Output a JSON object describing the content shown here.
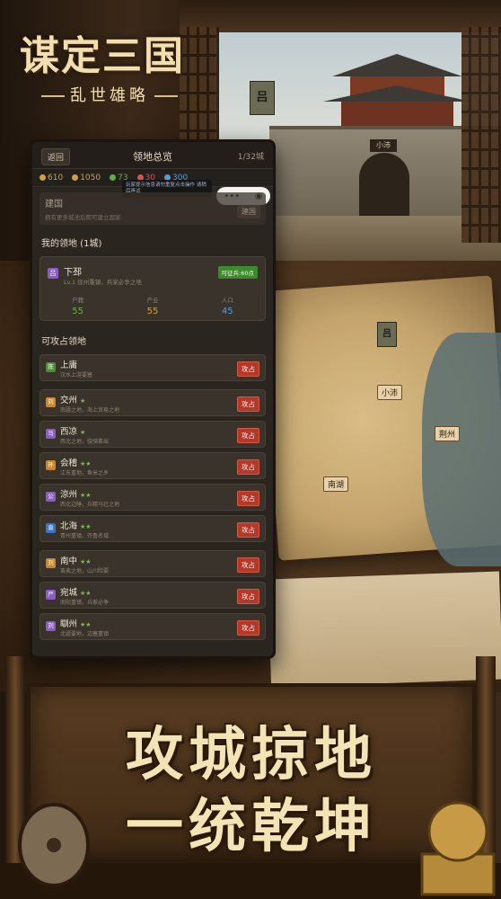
{
  "logo": {
    "title": "谋定三国",
    "subtitle": "乱世雄略"
  },
  "slogan": {
    "line1": "攻城掠地",
    "line2": "一统乾坤"
  },
  "scene": {
    "flag_char": "吕",
    "gate_plaque": "小沛",
    "map_labels": [
      "小沛",
      "荆州",
      "南湖"
    ]
  },
  "panel": {
    "back_label": "返回",
    "title": "领地总览",
    "count": "1/32城",
    "resources": [
      {
        "icon": "coin-icon",
        "value": "610",
        "color": "#c9a24a"
      },
      {
        "icon": "food-icon",
        "value": "1050",
        "color": "#c9a24a"
      },
      {
        "icon": "soldier-icon",
        "value": "73",
        "color": "#6aa84f"
      },
      {
        "icon": "power-icon",
        "value": "30",
        "color": "#d9534f"
      },
      {
        "icon": "gem-icon",
        "value": "300",
        "color": "#5b9bd5"
      }
    ],
    "toast": "玩家提示信息请勿重复点击操作 请稍后再试",
    "build": {
      "title": "建国",
      "desc": "拥有更多城池后即可建立国家",
      "button": "建国"
    },
    "own_section": "我的领地 (1城)",
    "own_city": {
      "badge": "吕",
      "name": "下邳",
      "sub": "Lv.1 徐州重镇，兵家必争之地",
      "tag": "可征兵:60点",
      "stats": [
        {
          "label": "户籍",
          "value": "55",
          "color": "#6aa84f"
        },
        {
          "label": "产业",
          "value": "55",
          "color": "#d4a03a"
        },
        {
          "label": "人口",
          "value": "45",
          "color": "#5b9bd5"
        }
      ]
    },
    "attack_section": "可攻占领地",
    "attack_label": "攻占",
    "targets": [
      {
        "badge": "陈",
        "badge_color": "#4d8b3a",
        "name": "上庸",
        "stars": "",
        "desc": "汉水上游要塞"
      },
      {
        "badge": "刘",
        "badge_color": "#c9872c",
        "name": "交州",
        "stars": "★",
        "desc": "南疆之地，海上贸易之地"
      },
      {
        "badge": "马",
        "badge_color": "#8b5cc7",
        "name": "西凉",
        "stars": "★",
        "desc": "西北之地，骁骑辈出"
      },
      {
        "badge": "孙",
        "badge_color": "#c9872c",
        "name": "会稽",
        "stars": "★★",
        "desc": "江东重地，鱼米之乡"
      },
      {
        "badge": "公",
        "badge_color": "#8b5cc7",
        "name": "涼州",
        "stars": "★★",
        "desc": "西北边陲，兵精马壮之地"
      },
      {
        "badge": "袁",
        "badge_color": "#3a74c4",
        "name": "北海",
        "stars": "★★",
        "desc": "青州重镇，齐鲁名城"
      },
      {
        "badge": "刘",
        "badge_color": "#c9872c",
        "name": "南中",
        "stars": "★★",
        "desc": "蛮夷之地，山川险要"
      },
      {
        "badge": "严",
        "badge_color": "#8b5cc7",
        "name": "宛城",
        "stars": "★★",
        "desc": "南阳重镇，兵家必争"
      },
      {
        "badge": "刘",
        "badge_color": "#8b5cc7",
        "name": "瞓州",
        "stars": "★★",
        "desc": "北疆要地，边塞重镇"
      }
    ]
  }
}
